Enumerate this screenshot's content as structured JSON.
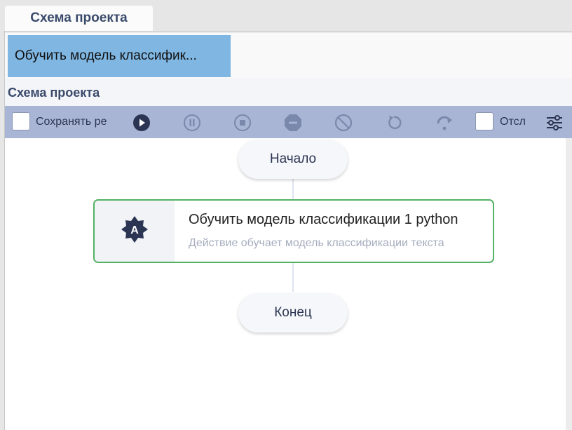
{
  "tab": {
    "label": "Схема проекта"
  },
  "selected_item": {
    "label": "Обучить модель классифик..."
  },
  "section": {
    "title": "Схема проекта"
  },
  "toolbar": {
    "save_label": "Сохранять ре",
    "filter_label": "Отсл",
    "icons": [
      "play-icon",
      "pause-icon",
      "stop-icon",
      "block-icon",
      "cancel-icon",
      "undo-icon",
      "redo-icon",
      "settings-sliders-icon"
    ]
  },
  "flow": {
    "start_label": "Начало",
    "end_label": "Конец",
    "node": {
      "title": "Обучить модель классификации 1 python",
      "description": "Действие обучает модель классификации текста",
      "icon": "auto-badge-icon",
      "icon_letter": "A",
      "border_color": "#53b263"
    }
  },
  "colors": {
    "accent": "#7fb6e2",
    "toolbar": "#a9b5d4",
    "icon_dark": "#2b3553",
    "icon_muted": "#7a88ab"
  }
}
